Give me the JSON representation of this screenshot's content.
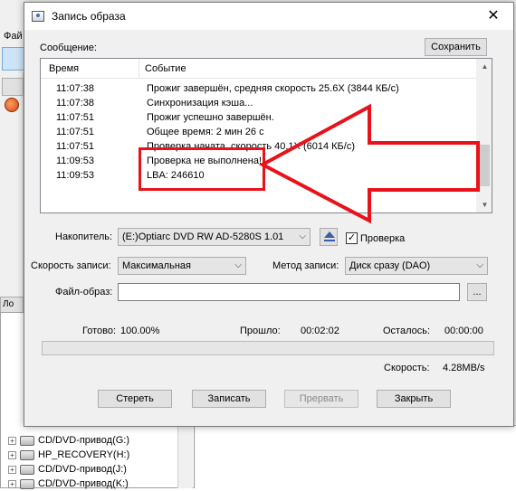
{
  "background_app": {
    "menu_partial": "Фай",
    "left_label_partial": "Ло",
    "tree_items": [
      {
        "label": "CD/DVD-привод(G:)"
      },
      {
        "label": "HP_RECOVERY(H:)"
      },
      {
        "label": "CD/DVD-привод(J:)"
      },
      {
        "label": "CD/DVD-привод(K:)"
      }
    ],
    "tree_plus": "+"
  },
  "dialog": {
    "title": "Запись образа",
    "close_glyph": "✕",
    "message_label": "Сообщение:",
    "save_button": "Сохранить",
    "log": {
      "col_time": "Время",
      "col_event": "Событие",
      "rows": [
        {
          "time": "11:07:38",
          "event": "Прожиг завершён, средняя скорость 25.6X (3844 КБ/с)"
        },
        {
          "time": "11:07:38",
          "event": "Синхронизация кэша..."
        },
        {
          "time": "11:07:51",
          "event": "Прожиг успешно завершён."
        },
        {
          "time": "11:07:51",
          "event": "Общее время: 2 мин 26 с"
        },
        {
          "time": "11:07:51",
          "event": "Проверка начата, скорость 40.1X (6014 КБ/с)"
        },
        {
          "time": "11:09:53",
          "event": "Проверка не выполнена!"
        },
        {
          "time": "11:09:53",
          "event": "LBA: 246610"
        }
      ],
      "scroll_up": "▲",
      "scroll_down": "▼"
    },
    "drive_label": "Накопитель:",
    "drive_value": "(E:)Optiarc DVD RW AD-5280S 1.01",
    "verify_label": "Проверка",
    "verify_mark": "✓",
    "verify_checked": true,
    "speed_label": "Скорость записи:",
    "speed_value": "Максимальная",
    "method_label": "Метод записи:",
    "method_value": "Диск сразу (DAO)",
    "image_file_label": "Файл-образ:",
    "image_file_value": "",
    "browse_button": "...",
    "dropdown_arrow": "⌵",
    "status": {
      "done_label": "Готово:",
      "done_value": "100.00%",
      "elapsed_label": "Прошло:",
      "elapsed_value": "00:02:02",
      "remaining_label": "Осталось:",
      "remaining_value": "00:00:00",
      "speed_label": "Скорость:",
      "speed_value": "4.28MB/s"
    },
    "progress_fraction": 0.0,
    "buttons": {
      "erase": "Стереть",
      "burn": "Записать",
      "abort": "Прервать",
      "close": "Закрыть"
    }
  },
  "colors": {
    "annotation_red": "#e8121b",
    "dialog_bg": "#f0f0f0"
  }
}
